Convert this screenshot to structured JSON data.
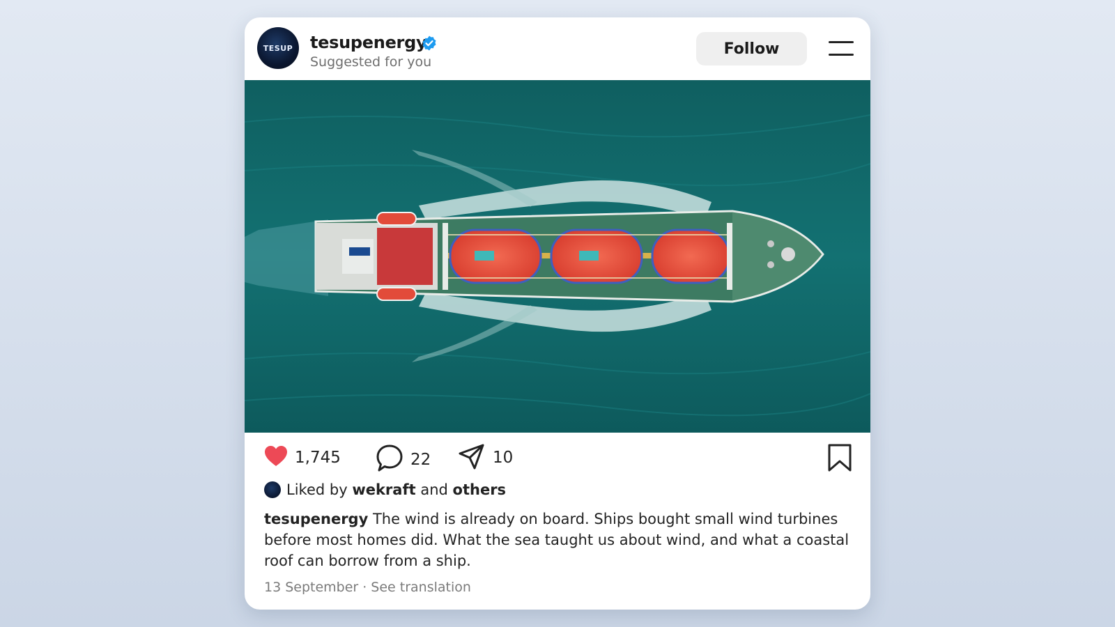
{
  "post": {
    "username": "tesupenergy",
    "subtitle": "Suggested for you",
    "avatar_text": "TESUP",
    "follow_label": "Follow",
    "likes": "1,745",
    "comments": "22",
    "shares": "10",
    "liked_by_prefix": "Liked by",
    "liked_by_user": "wekraft",
    "liked_by_and": "and",
    "liked_by_others": "others",
    "caption_user": "tesupenergy",
    "caption_text": "The wind is already on board. Ships bought small wind turbines before most homes did. What the sea taught us about wind, and what a coastal roof can borrow from a ship.",
    "date": "13 September",
    "separator": "·",
    "see_translation": "See translation"
  },
  "icons": {
    "verified": "verified-badge-icon",
    "menu": "menu-icon",
    "like": "heart-icon",
    "comment": "comment-icon",
    "share": "send-icon",
    "save": "bookmark-icon"
  },
  "colors": {
    "heart": "#ed4956",
    "verified": "#1d9bf0",
    "follow_bg": "#efefef"
  }
}
